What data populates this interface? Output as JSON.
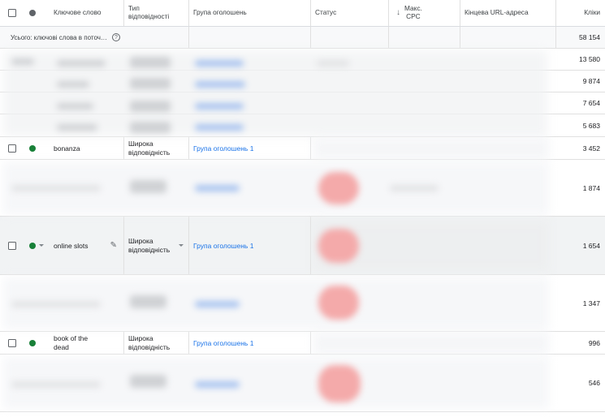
{
  "header": {
    "keyword": "Ключове слово",
    "match_type_line1": "Тип",
    "match_type_line2": "відповідності",
    "ad_group": "Група оголошень",
    "status": "Статус",
    "max_cpc_line1": "Макс.",
    "max_cpc_line2": "CPC",
    "final_url": "Кінцева URL-адреса",
    "clicks": "Кліки"
  },
  "summary": {
    "label": "Усього: ключові слова в поточ…",
    "help": "?",
    "clicks": "58 154"
  },
  "rows": [
    {
      "clicks": "13 580"
    },
    {
      "clicks": "9 874"
    },
    {
      "clicks": "7 654"
    },
    {
      "clicks": "5 683"
    },
    {
      "keyword": "bonanza",
      "match_line1": "Широка",
      "match_line2": "відповідність",
      "ad_group": "Група оголошень 1",
      "clicks": "3 452"
    },
    {
      "clicks": "1 874"
    },
    {
      "keyword": "online slots",
      "match_line1": "Широка",
      "match_line2": "відповідність",
      "ad_group": "Група оголошень 1",
      "clicks": "1 654"
    },
    {
      "clicks": "1 347"
    },
    {
      "keyword_line1": "book of the",
      "keyword_line2": "dead",
      "match_line1": "Широка",
      "match_line2": "відповідність",
      "ad_group": "Група оголошень 1",
      "clicks": "996"
    },
    {
      "clicks": "546"
    }
  ],
  "icons": {
    "arrow": "↓",
    "pencil": "✎"
  },
  "colors": {
    "enabled_status": "#188038",
    "link": "#1a73e8"
  }
}
